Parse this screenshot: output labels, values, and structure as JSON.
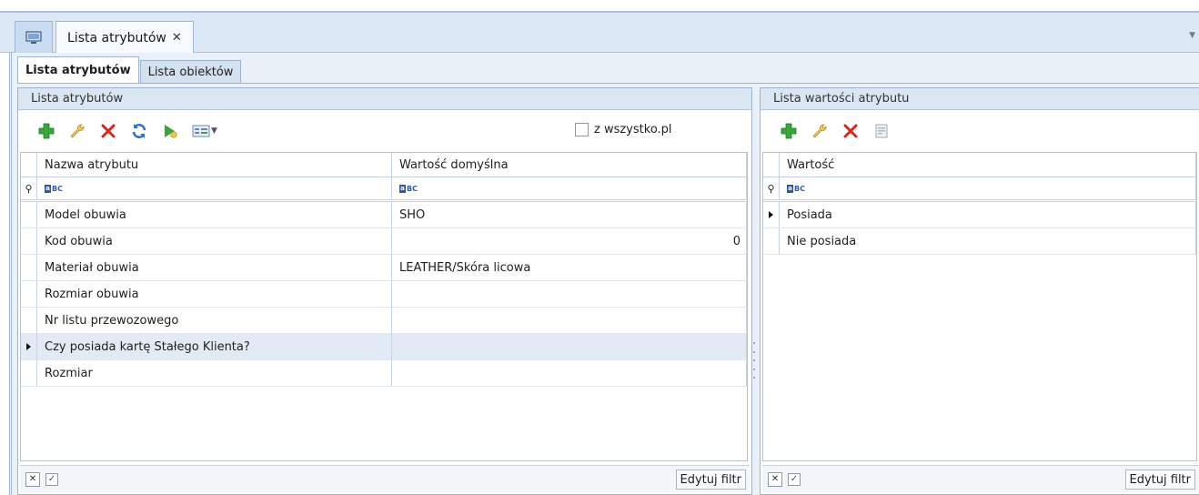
{
  "document_tab": {
    "title": "Lista atrybutów",
    "close": "✕"
  },
  "subtabs": [
    {
      "label": "Lista atrybutów",
      "active": true
    },
    {
      "label": "Lista obiektów",
      "active": false
    }
  ],
  "left_panel": {
    "header": "Lista atrybutów",
    "checkbox_label": "z wszystko.pl",
    "columns": [
      "Nazwa atrybutu",
      "Wartość domyślna"
    ],
    "rows": [
      {
        "name": "Model obuwia",
        "default": "SHO"
      },
      {
        "name": "Kod obuwia",
        "default": "0"
      },
      {
        "name": "Materiał obuwia",
        "default": "LEATHER/Skóra licowa"
      },
      {
        "name": "Rozmiar obuwia",
        "default": ""
      },
      {
        "name": "Nr listu przewozowego",
        "default": ""
      },
      {
        "name": "Czy posiada kartę Stałego Klienta?",
        "default": ""
      },
      {
        "name": "Rozmiar",
        "default": ""
      }
    ],
    "edit_filter": "Edytuj filtr"
  },
  "right_panel": {
    "header": "Lista wartości atrybutu",
    "columns": [
      "Wartość"
    ],
    "rows": [
      {
        "value": "Posiada"
      },
      {
        "value": "Nie posiada"
      }
    ],
    "edit_filter": "Edytuj filtr"
  },
  "colors": {
    "accent": "#2b5aa8",
    "add_green": "#3aa53a",
    "delete_red": "#d9261c",
    "header_bg": "#dbe6f3"
  }
}
